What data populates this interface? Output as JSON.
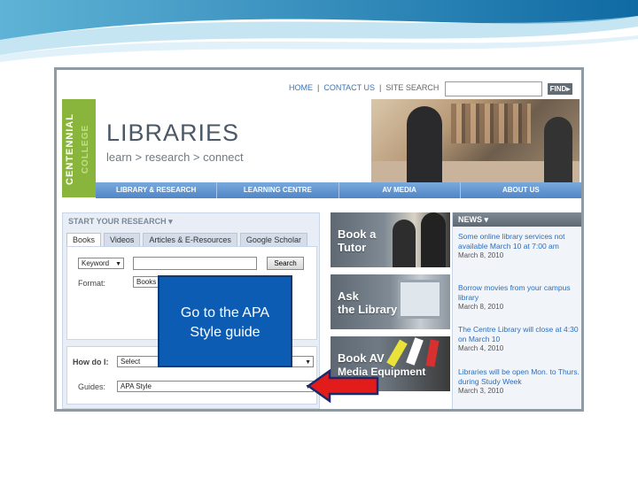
{
  "top_nav": {
    "home": "HOME",
    "separator": "|",
    "contact": "CONTACT US",
    "site_search_label": "SITE SEARCH",
    "find_label": "FIND▸"
  },
  "brand": {
    "college_name": "CENTENNIAL",
    "college_word": "COLLEGE",
    "title": "LIBRARIES",
    "tagline": "learn > research > connect"
  },
  "main_nav": [
    "LIBRARY & RESEARCH",
    "LEARNING CENTRE",
    "AV MEDIA",
    "ABOUT US"
  ],
  "research": {
    "title": "START YOUR RESEARCH ▾",
    "tabs": [
      "Books",
      "Videos",
      "Articles & E-Resources",
      "Google Scholar"
    ],
    "keyword_select": "Keyword",
    "search_button": "Search",
    "format_label": "Format:",
    "format_value": "Books",
    "howdoi_label": "How do I:",
    "howdoi_value": "Select",
    "guides_label": "Guides:",
    "guides_value": "APA Style"
  },
  "tiles": [
    {
      "label_line1": "Book a",
      "label_line2": "Tutor"
    },
    {
      "label_line1": "Ask",
      "label_line2": "the Library"
    },
    {
      "label_line1": "Book AV",
      "label_line2": "Media Equipment"
    }
  ],
  "news": {
    "heading": "NEWS ▾",
    "items": [
      {
        "text": "Some online library services not available March 10 at 7:00 am",
        "date": "March 8, 2010"
      },
      {
        "text": "Borrow movies from your campus library",
        "date": "March 8, 2010"
      },
      {
        "text": "The Centre Library will close at 4:30 on March 10",
        "date": "March 4, 2010"
      },
      {
        "text": "Libraries will be open Mon. to Thurs. during Study Week",
        "date": "March 3, 2010"
      }
    ]
  },
  "callout": {
    "line1": "Go to the APA",
    "line2": "Style guide"
  },
  "colors": {
    "callout_blue": "#0d5cb4",
    "arrow_red": "#e21b1b",
    "nav_blue": "#4f86c6",
    "centennial_green": "#8ab53d"
  }
}
